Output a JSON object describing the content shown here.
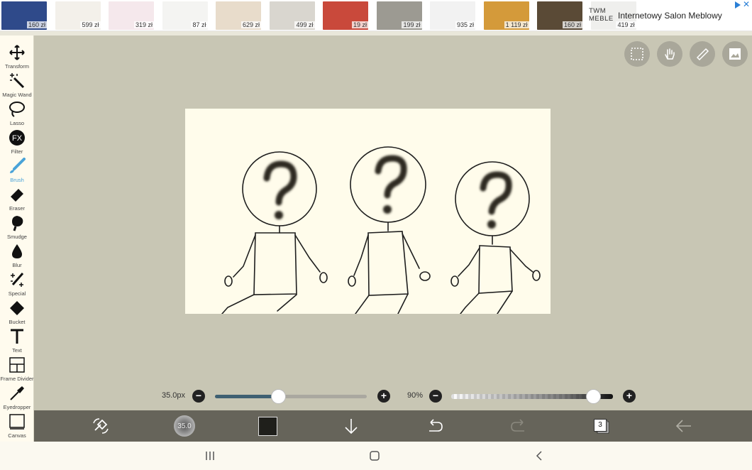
{
  "ad": {
    "items": [
      {
        "price": "160 zł",
        "color": "#2f4a8a"
      },
      {
        "price": "599 zł",
        "color": "#f3f0ea"
      },
      {
        "price": "319 zł",
        "color": "#f5e8ec"
      },
      {
        "price": "87 zł",
        "color": "#f4f4f2"
      },
      {
        "price": "629 zł",
        "color": "#e8dccb"
      },
      {
        "price": "499 zł",
        "color": "#d9d6cf"
      },
      {
        "price": "19 zł",
        "color": "#c9493b"
      },
      {
        "price": "199 zł",
        "color": "#9c9a92"
      },
      {
        "price": "935 zł",
        "color": "#f2f2f2"
      },
      {
        "price": "1 119 zł",
        "color": "#d49a3a"
      },
      {
        "price": "160 zł",
        "color": "#5a4a36"
      },
      {
        "price": "419 zł",
        "color": "#efefed"
      }
    ],
    "brand": "TWM MEBLE",
    "title": "Internetowy Salon Meblowy",
    "close": "✕"
  },
  "tools": [
    {
      "label": "Transform",
      "icon": "move-icon"
    },
    {
      "label": "Magic Wand",
      "icon": "magic-wand-icon"
    },
    {
      "label": "Lasso",
      "icon": "lasso-icon"
    },
    {
      "label": "Filter",
      "icon": "fx-icon"
    },
    {
      "label": "Brush",
      "icon": "brush-icon",
      "active": true
    },
    {
      "label": "Eraser",
      "icon": "eraser-icon"
    },
    {
      "label": "Smudge",
      "icon": "smudge-icon"
    },
    {
      "label": "Blur",
      "icon": "drop-icon"
    },
    {
      "label": "Special",
      "icon": "sparkle-icon"
    },
    {
      "label": "Bucket",
      "icon": "bucket-icon"
    },
    {
      "label": "Text",
      "icon": "text-icon"
    },
    {
      "label": "Frame Divider",
      "icon": "frame-divider-icon"
    },
    {
      "label": "Eyedropper",
      "icon": "eyedropper-icon"
    },
    {
      "label": "Canvas",
      "icon": "canvas-icon"
    }
  ],
  "top_actions": [
    "selection-icon",
    "hand-icon",
    "ruler-icon",
    "image-icon"
  ],
  "brush_size": {
    "label": "35.0px",
    "value_fraction": 0.42
  },
  "opacity": {
    "label": "90%",
    "value_fraction": 0.9
  },
  "bottom_bar": {
    "brush_preview_text": "35.0",
    "color": "#1f1f1b",
    "layers_count": "3"
  },
  "colors": {
    "accent": "#4aa3d8",
    "workspace": "#c8c6b4",
    "bottom_bar": "#66645a",
    "paper": "#fffceb"
  }
}
